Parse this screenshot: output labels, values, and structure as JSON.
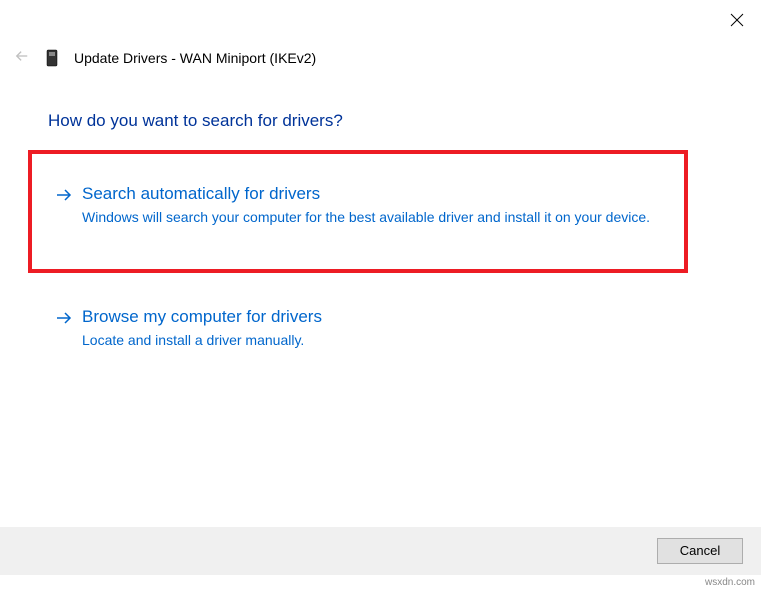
{
  "header": {
    "title": "Update Drivers - WAN Miniport (IKEv2)"
  },
  "heading": "How do you want to search for drivers?",
  "options": {
    "auto": {
      "title": "Search automatically for drivers",
      "desc": "Windows will search your computer for the best available driver and install it on your device."
    },
    "browse": {
      "title": "Browse my computer for drivers",
      "desc": "Locate and install a driver manually."
    }
  },
  "footer": {
    "cancel": "Cancel"
  },
  "watermark": "wsxdn.com"
}
